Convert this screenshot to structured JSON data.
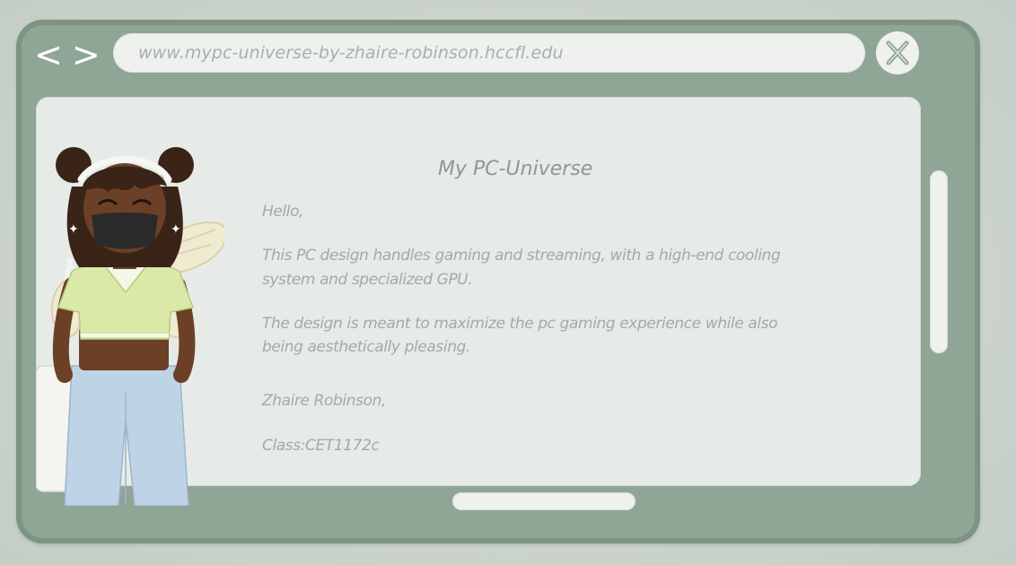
{
  "browser": {
    "back_label": "<",
    "forward_label": ">",
    "url": "www.mypc-universe-by-zhaire-robinson.hccfl.edu",
    "close_label": "X"
  },
  "letter": {
    "title": "My PC-Universe",
    "greeting": "Hello,",
    "paragraph1_line1": "This PC design handles gaming and streaming, with a high-end cooling",
    "paragraph1_line2": "system and specialized GPU.",
    "paragraph2_line1": "The design is meant to maximize the pc gaming experience while also",
    "paragraph2_line2": "being aesthetically pleasing.",
    "signature": "Zhaire Robinson,",
    "class_line": "Class:CET1172c"
  },
  "icons": {
    "close": "close-x-icon",
    "back": "chevron-left-icon",
    "forward": "chevron-right-icon"
  },
  "colors": {
    "frame": "#8fa595",
    "panel": "#e7ebe8",
    "text": "#a3aaa5"
  }
}
